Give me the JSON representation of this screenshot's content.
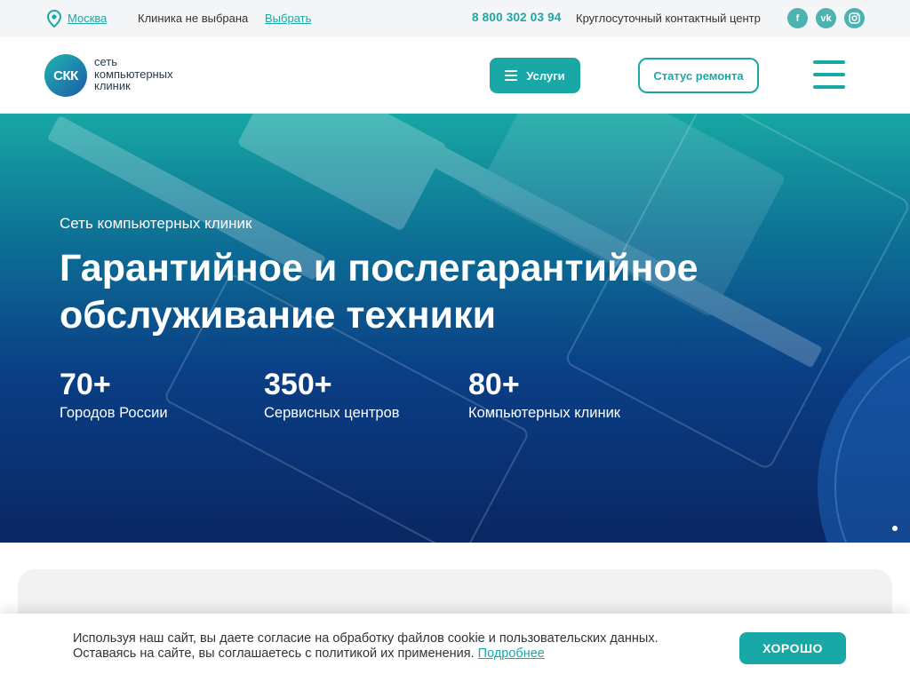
{
  "topbar": {
    "city": "Москва",
    "clinic_status": "Клиника не выбрана",
    "choose_label": "Выбрать",
    "phone": "8 800 302 03 94",
    "contact_center": "Круглосуточный контактный центр",
    "socials": {
      "facebook": "f",
      "vk": "vk",
      "instagram": "instagram-icon"
    }
  },
  "header": {
    "logo_mark": "СКК",
    "logo_lines": [
      "сеть",
      "компьютерных",
      "клиник"
    ],
    "services_label": "Услуги",
    "status_label": "Статус ремонта"
  },
  "hero": {
    "subtitle": "Сеть компьютерных клиник",
    "title": "Гарантийное и послегарантийное обслуживание техники",
    "stats": [
      {
        "value": "70+",
        "label": "Городов России"
      },
      {
        "value": "350+",
        "label": "Сервисных центров"
      },
      {
        "value": "80+",
        "label": "Компьютерных клиник"
      }
    ]
  },
  "cookie": {
    "line1": "Используя наш сайт, вы даете согласие на обработку файлов cookie и пользовательских данных.",
    "line2": "Оставаясь на сайте, вы соглашаетесь с политикой их применения.",
    "link": "Подробнее",
    "ok_label": "ХОРОШО"
  },
  "colors": {
    "accent": "#1aa8a6",
    "hero_top": "#17a7a4",
    "hero_bottom": "#0a2663"
  }
}
